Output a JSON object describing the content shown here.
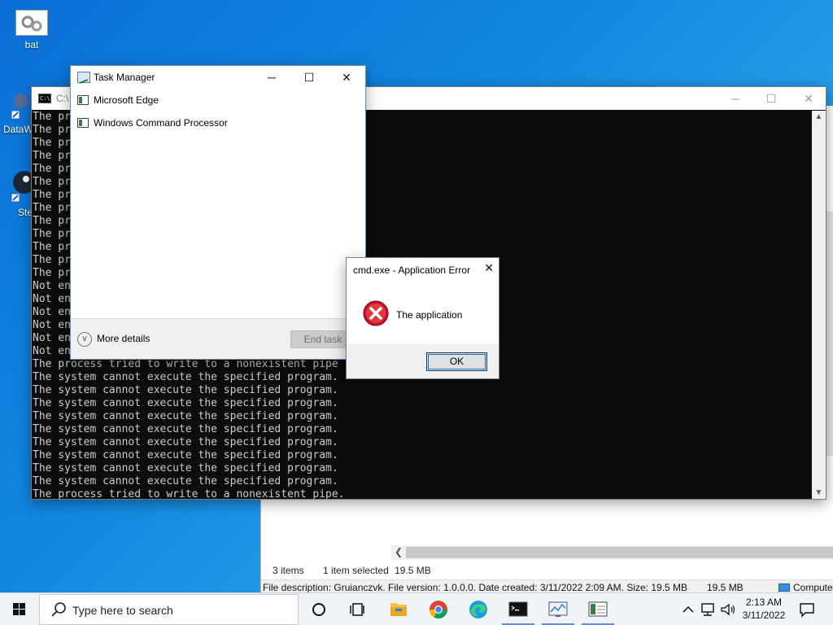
{
  "desktop": {
    "icons": [
      {
        "label": "bat"
      },
      {
        "label": "DataW"
      },
      {
        "label": "Ste"
      }
    ]
  },
  "explorer": {
    "status": {
      "items": "3 items",
      "selected": "1 item selected",
      "size": "19.5 MB"
    },
    "details": {
      "text": "File description: Gruianczvk. File version: 1.0.0.0. Date created: 3/11/2022 2:09 AM. Size: 19.5 MB",
      "size": "19.5 MB",
      "location": "Compute"
    }
  },
  "cmd": {
    "title": "C:\\",
    "lines": [
      "The pr",
      "The pr",
      "The pr",
      "The pr",
      "The pr",
      "The pr",
      "The pr",
      "The pr",
      "The pr",
      "The pr",
      "The pr",
      "The pr",
      "The pr",
      "Not en",
      "Not en",
      "Not en",
      "Not en",
      "Not en",
      "Not en",
      "The process tried to write to a nonexistent pipe",
      "The system cannot execute the specified program.",
      "The system cannot execute the specified program.",
      "The system cannot execute the specified program.",
      "The system cannot execute the specified program.",
      "The system cannot execute the specified program.",
      "The system cannot execute the specified program.",
      "The system cannot execute the specified program.",
      "The system cannot execute the specified program.",
      "The system cannot execute the specified program.",
      "The process tried to write to a nonexistent pipe."
    ]
  },
  "taskmanager": {
    "title": "Task Manager",
    "apps": [
      {
        "name": "Microsoft Edge"
      },
      {
        "name": "Windows Command Processor"
      }
    ],
    "more_details": "More details",
    "end_task": "End task"
  },
  "error_dialog": {
    "title": "cmd.exe - Application Error",
    "message": "The application",
    "ok": "OK"
  },
  "taskbar": {
    "search_placeholder": "Type here to search",
    "time": "2:13 AM",
    "date": "3/11/2022"
  },
  "colors": {
    "console_bg": "#0c0c0c",
    "console_fg": "#cccccc",
    "desktop": "#1188e0",
    "accent": "#0078d7"
  }
}
